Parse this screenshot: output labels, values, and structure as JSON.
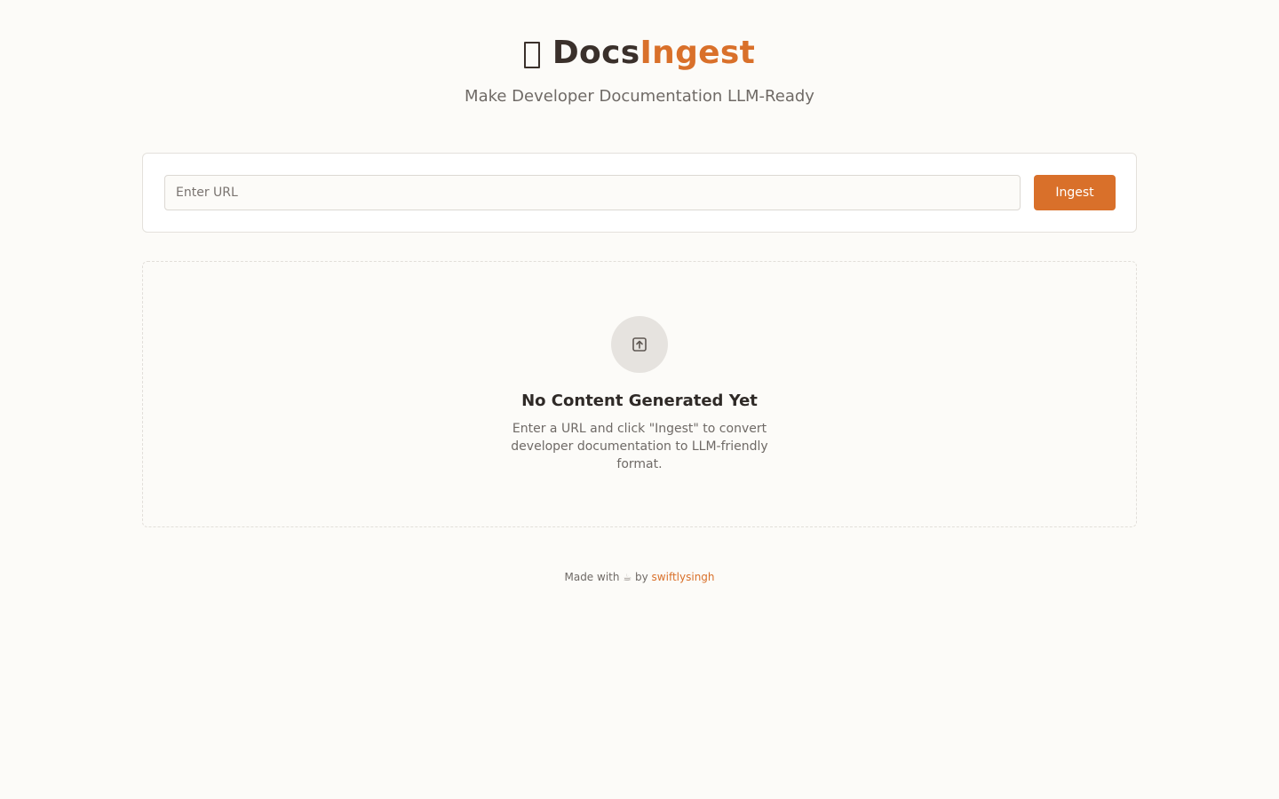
{
  "header": {
    "title_part1": "Docs",
    "title_part2": "Ingest",
    "brand_icon": "book-icon",
    "subtitle": "Make Developer Documentation LLM-Ready"
  },
  "form": {
    "url_placeholder": "Enter URL",
    "url_value": "",
    "ingest_label": "Ingest"
  },
  "empty_state": {
    "icon": "upload-box-icon",
    "title": "No Content Generated Yet",
    "description": "Enter a URL and click \"Ingest\" to convert developer documentation to LLM-friendly format."
  },
  "footer": {
    "made_with": "Made with",
    "cup": "☕",
    "by": "by",
    "author": "swiftlysingh"
  },
  "colors": {
    "background": "#fcfbf8",
    "accent": "#d9702a",
    "text_dark": "#3a302b",
    "text_muted": "#6f6a66"
  }
}
